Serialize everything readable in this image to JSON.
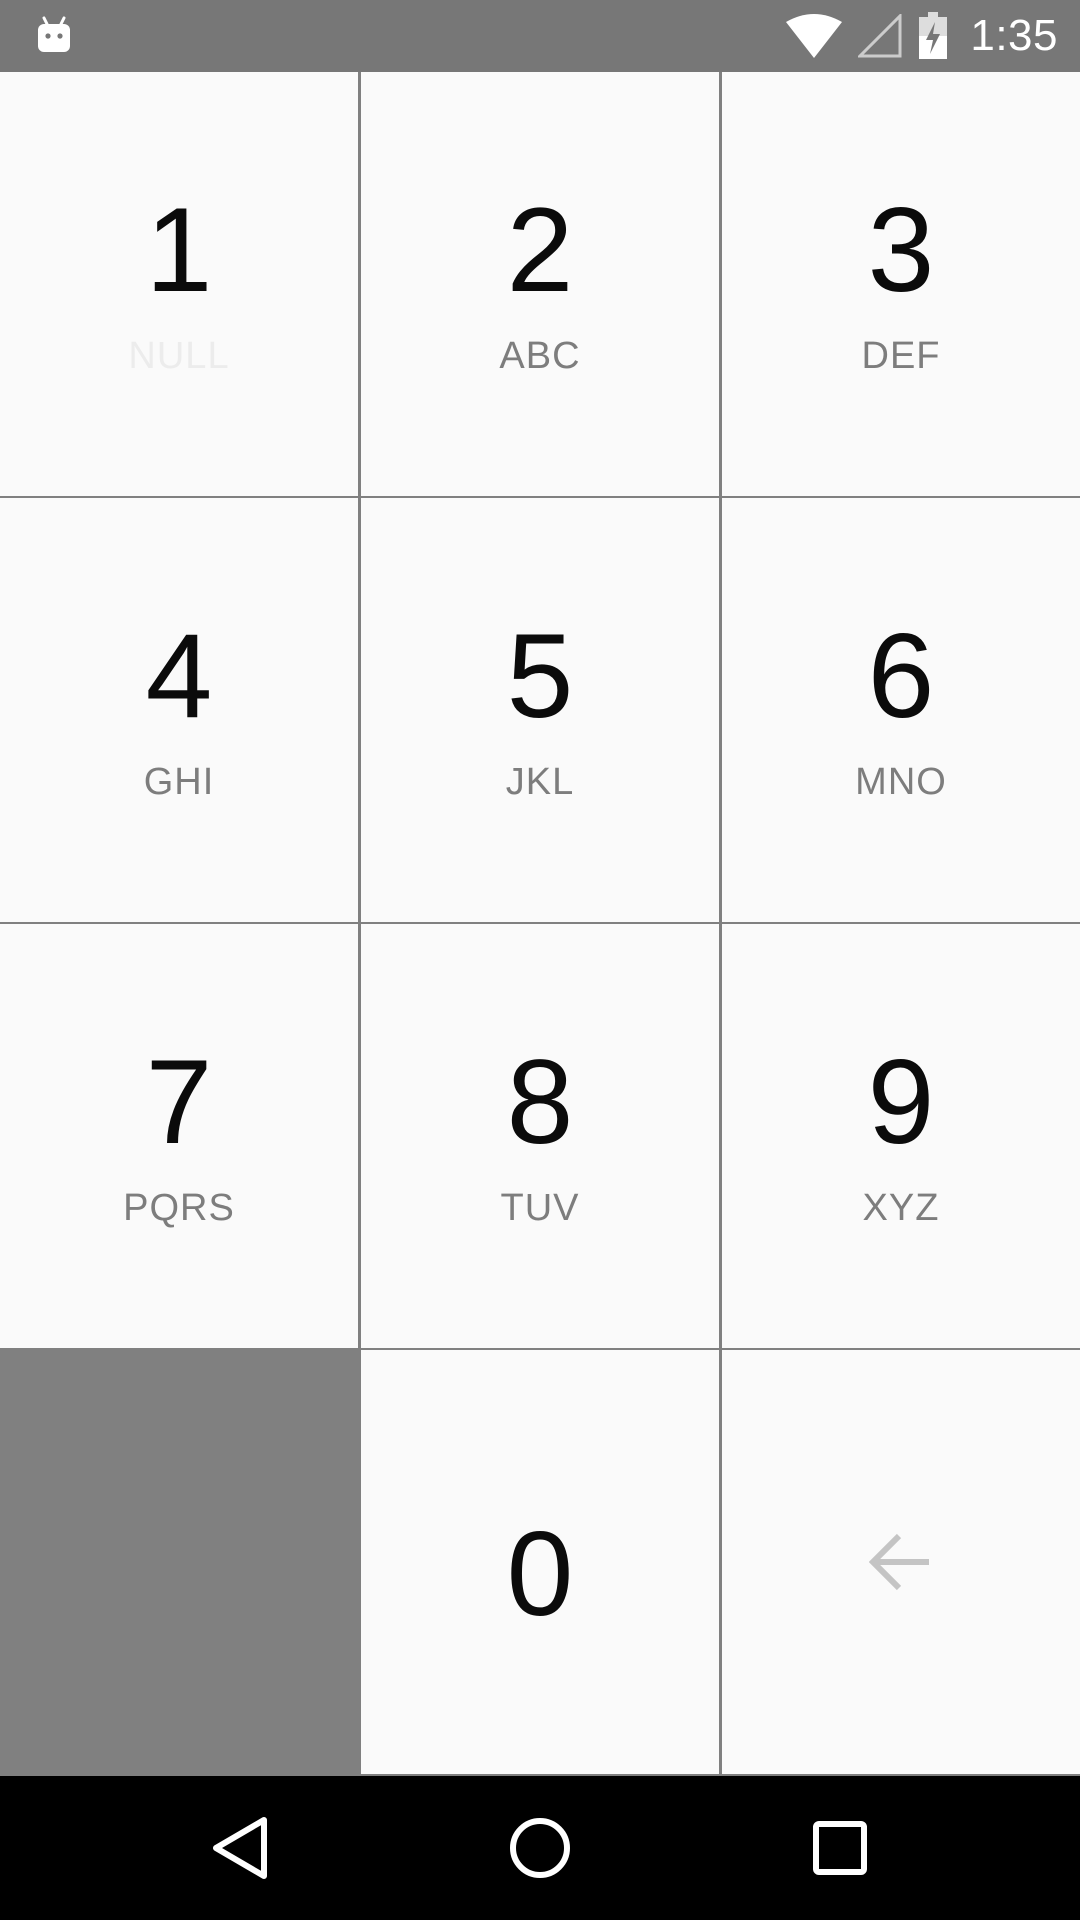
{
  "status_bar": {
    "time": "1:35",
    "icons": [
      "android-icon",
      "wifi-icon",
      "signal-icon",
      "battery-charging-icon"
    ],
    "background": "#777777"
  },
  "keypad": {
    "keys": [
      {
        "digit": "1",
        "letters": "NULL"
      },
      {
        "digit": "2",
        "letters": "ABC"
      },
      {
        "digit": "3",
        "letters": "DEF"
      },
      {
        "digit": "4",
        "letters": "GHI"
      },
      {
        "digit": "5",
        "letters": "JKL"
      },
      {
        "digit": "6",
        "letters": "MNO"
      },
      {
        "digit": "7",
        "letters": "PQRS"
      },
      {
        "digit": "8",
        "letters": "TUV"
      },
      {
        "digit": "9",
        "letters": "XYZ"
      },
      {
        "digit": "0",
        "letters": ""
      }
    ],
    "backspace_icon": "backspace-arrow-icon",
    "key_background": "#fafafa",
    "blank_key_color": "#808080",
    "digit_color": "#0b0b0b",
    "letters_color": "#7d7d7d"
  },
  "nav_bar": {
    "icons": [
      "back-icon",
      "home-icon",
      "recents-icon"
    ],
    "background": "#000000"
  }
}
